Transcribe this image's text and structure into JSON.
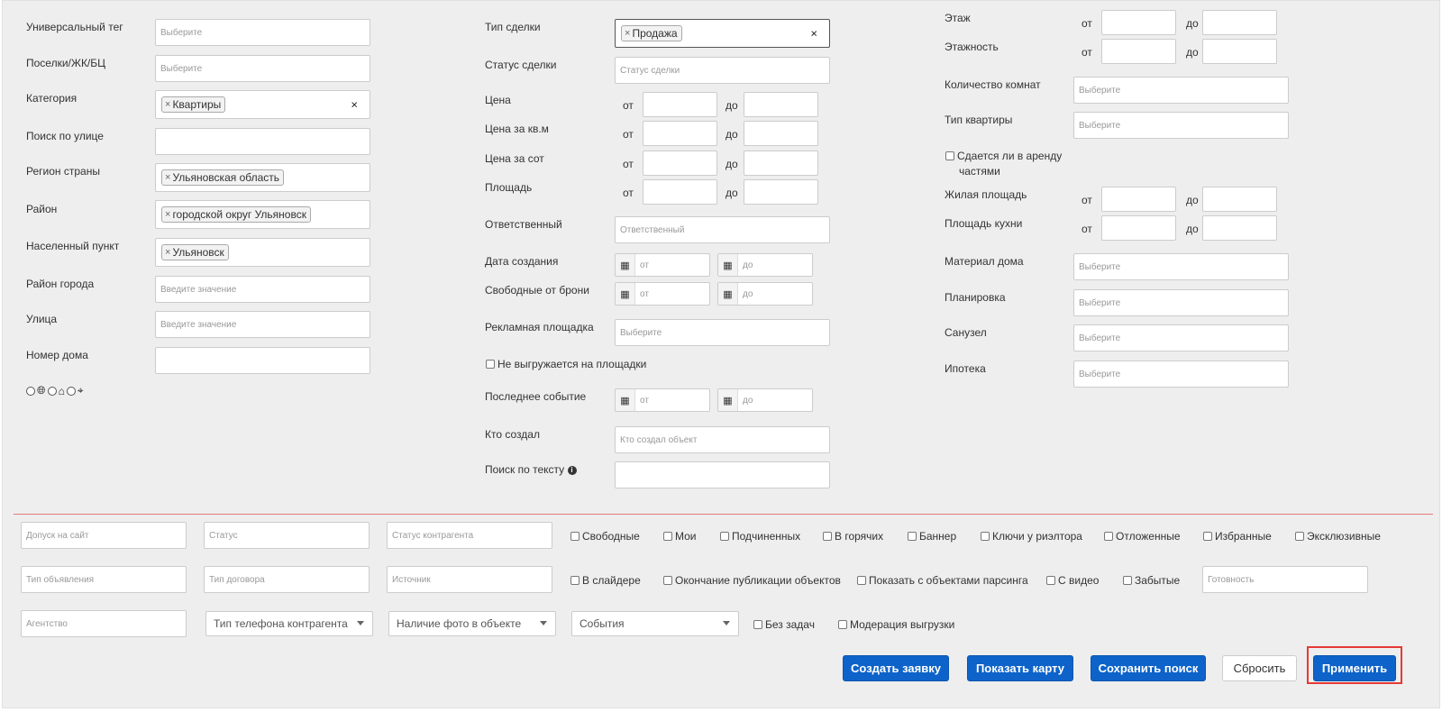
{
  "left": {
    "fields": [
      {
        "label": "Универсальный тег",
        "placeholder": "Выберите"
      },
      {
        "label": "Поселки/ЖК/БЦ",
        "placeholder": "Выберите"
      },
      {
        "label": "Категория",
        "tag": "Квартиры"
      },
      {
        "label": "Поиск по улице",
        "placeholder": ""
      },
      {
        "label": "Регион страны",
        "tag": "Ульяновская область"
      },
      {
        "label": "Район",
        "tag": "городской округ Ульяновск"
      },
      {
        "label": "Населенный пункт",
        "tag": "Ульяновск"
      },
      {
        "label": "Район города",
        "placeholder": "Введите значение"
      },
      {
        "label": "Улица",
        "placeholder": "Введите значение"
      },
      {
        "label": "Номер дома",
        "placeholder": ""
      }
    ],
    "map_mode_icons": [
      "globe-icon",
      "home-icon",
      "crosshair-icon"
    ]
  },
  "middle": {
    "deal_type": {
      "label": "Тип сделки",
      "tag": "Продажа"
    },
    "deal_status": {
      "label": "Статус сделки",
      "placeholder": "Статус сделки"
    },
    "ranges": [
      {
        "label": "Цена",
        "from": "от",
        "to": "до"
      },
      {
        "label": "Цена за кв.м",
        "from": "от",
        "to": "до"
      },
      {
        "label": "Цена за сот",
        "from": "от",
        "to": "до"
      },
      {
        "label": "Площадь",
        "from": "от",
        "to": "до"
      }
    ],
    "responsible": {
      "label": "Ответственный",
      "placeholder": "Ответственный"
    },
    "created_date": {
      "label": "Дата создания",
      "from_ph": "от",
      "to_ph": "до"
    },
    "free_from_booking": {
      "label": "Свободные от брони",
      "from_ph": "от",
      "to_ph": "до"
    },
    "ad_platform": {
      "label": "Рекламная площадка",
      "placeholder": "Выберите"
    },
    "not_exported": "Не выгружается на площадки",
    "last_event": {
      "label": "Последнее событие",
      "from_ph": "от",
      "to_ph": "до"
    },
    "created_by": {
      "label": "Кто создал",
      "placeholder": "Кто создал объект"
    },
    "text_search": {
      "label": "Поиск по тексту",
      "placeholder": ""
    }
  },
  "right": {
    "floor": {
      "label": "Этаж",
      "from": "от",
      "to": "до"
    },
    "floors_total": {
      "label": "Этажность",
      "from": "от",
      "to": "до"
    },
    "rooms": {
      "label": "Количество комнат",
      "placeholder": "Выберите"
    },
    "apt_type": {
      "label": "Тип квартиры",
      "placeholder": "Выберите"
    },
    "rent_parts_line1": "Сдается ли в аренду",
    "rent_parts_line2": "частями",
    "living_area": {
      "label": "Жилая площадь",
      "from": "от",
      "to": "до"
    },
    "kitchen_area": {
      "label": "Площадь кухни",
      "from": "от",
      "to": "до"
    },
    "material": {
      "label": "Материал дома",
      "placeholder": "Выберите"
    },
    "layout": {
      "label": "Планировка",
      "placeholder": "Выберите"
    },
    "bathroom": {
      "label": "Санузел",
      "placeholder": "Выберите"
    },
    "mortgage": {
      "label": "Ипотека",
      "placeholder": "Выберите"
    }
  },
  "bottom": {
    "row1_inputs": [
      "Допуск на сайт",
      "Статус",
      "Статус контрагента"
    ],
    "row1_checks": [
      "Свободные",
      "Мои",
      "Подчиненных",
      "В горячих",
      "Баннер",
      "Ключи у риэлтора",
      "Отложенные",
      "Избранные",
      "Эксклюзивные"
    ],
    "row2_inputs": [
      "Тип объявления",
      "Тип договора",
      "Источник"
    ],
    "row2_checks": [
      "В слайдере",
      "Окончание публикации объектов",
      "Показать с объектами парсинга",
      "С видео",
      "Забытые"
    ],
    "row2_readiness": "Готовность",
    "row3_input": "Агентство",
    "row3_selects": [
      "Тип телефона контрагента",
      "Наличие фото в объекте",
      "События"
    ],
    "row3_checks": [
      "Без задач",
      "Модерация выгрузки"
    ]
  },
  "buttons": {
    "create_request": "Создать заявку",
    "show_map": "Показать карту",
    "save_search": "Сохранить поиск",
    "reset": "Сбросить",
    "apply": "Применить"
  },
  "colors": {
    "primary": "#0d63c9",
    "highlight": "#e53935",
    "divider": "#e07a7a"
  }
}
